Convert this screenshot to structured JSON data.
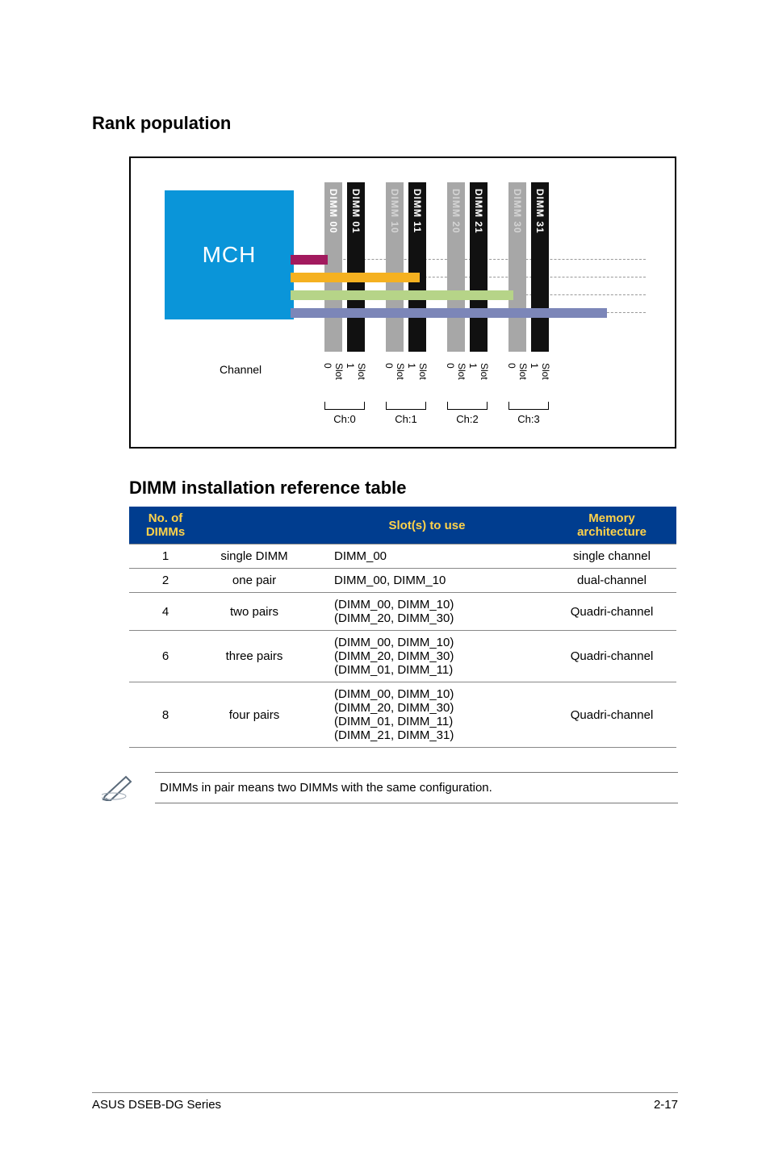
{
  "headings": {
    "rank_population": "Rank population",
    "dimm_table_title": "DIMM installation reference table"
  },
  "diagram": {
    "mch_label": "MCH",
    "channel_label": "Channel",
    "channels": [
      {
        "name": "Ch:0",
        "slots": [
          {
            "dimm": "DIMM 00",
            "slot": "Slot 0",
            "color": "grey",
            "faded": false
          },
          {
            "dimm": "DIMM 01",
            "slot": "Slot 1",
            "color": "black",
            "faded": false
          }
        ]
      },
      {
        "name": "Ch:1",
        "slots": [
          {
            "dimm": "DIMM 10",
            "slot": "Slot 0",
            "color": "grey",
            "faded": true
          },
          {
            "dimm": "DIMM 11",
            "slot": "Slot 1",
            "color": "black",
            "faded": false
          }
        ]
      },
      {
        "name": "Ch:2",
        "slots": [
          {
            "dimm": "DIMM 20",
            "slot": "Slot 0",
            "color": "grey",
            "faded": true
          },
          {
            "dimm": "DIMM 21",
            "slot": "Slot 1",
            "color": "black",
            "faded": false
          }
        ]
      },
      {
        "name": "Ch:3",
        "slots": [
          {
            "dimm": "DIMM 30",
            "slot": "Slot 0",
            "color": "grey",
            "faded": true
          },
          {
            "dimm": "DIMM 31",
            "slot": "Slot 1",
            "color": "black",
            "faded": false
          }
        ]
      }
    ]
  },
  "table": {
    "headers": {
      "no": "No. of DIMMs",
      "empty": "",
      "slots": "Slot(s) to use",
      "arch": "Memory architecture"
    },
    "rows": [
      {
        "no": "1",
        "desc": "single DIMM",
        "slots": "DIMM_00",
        "arch": "single channel"
      },
      {
        "no": "2",
        "desc": "one pair",
        "slots": "DIMM_00, DIMM_10",
        "arch": "dual-channel"
      },
      {
        "no": "4",
        "desc": "two pairs",
        "slots": "(DIMM_00, DIMM_10)\n(DIMM_20, DIMM_30)",
        "arch": "Quadri-channel"
      },
      {
        "no": "6",
        "desc": "three pairs",
        "slots": "(DIMM_00, DIMM_10)\n(DIMM_20, DIMM_30)\n(DIMM_01, DIMM_11)",
        "arch": "Quadri-channel"
      },
      {
        "no": "8",
        "desc": "four pairs",
        "slots": "(DIMM_00, DIMM_10)\n(DIMM_20, DIMM_30)\n(DIMM_01, DIMM_11)\n(DIMM_21, DIMM_31)",
        "arch": "Quadri-channel"
      }
    ]
  },
  "note": {
    "text": "DIMMs in pair means two DIMMs with the same configuration."
  },
  "footer": {
    "left": "ASUS DSEB-DG Series",
    "right": "2-17"
  },
  "chart_data": {
    "type": "table",
    "title": "DIMM installation reference table",
    "columns": [
      "No. of DIMMs",
      "",
      "Slot(s) to use",
      "Memory architecture"
    ],
    "rows": [
      [
        "1",
        "single DIMM",
        "DIMM_00",
        "single channel"
      ],
      [
        "2",
        "one pair",
        "DIMM_00, DIMM_10",
        "dual-channel"
      ],
      [
        "4",
        "two pairs",
        "(DIMM_00, DIMM_10) (DIMM_20, DIMM_30)",
        "Quadri-channel"
      ],
      [
        "6",
        "three pairs",
        "(DIMM_00, DIMM_10) (DIMM_20, DIMM_30) (DIMM_01, DIMM_11)",
        "Quadri-channel"
      ],
      [
        "8",
        "four pairs",
        "(DIMM_00, DIMM_10) (DIMM_20, DIMM_30) (DIMM_01, DIMM_11) (DIMM_21, DIMM_31)",
        "Quadri-channel"
      ]
    ]
  }
}
